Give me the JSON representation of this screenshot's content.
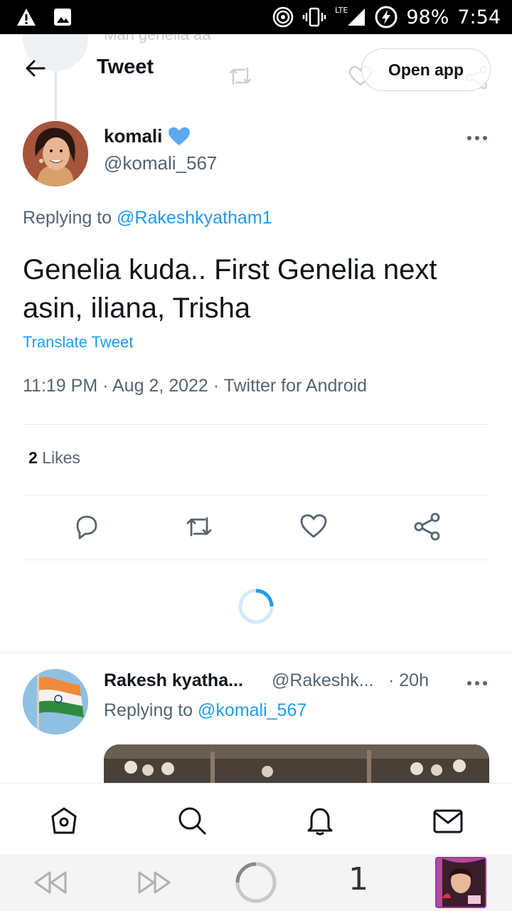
{
  "status_bar": {
    "battery": "98%",
    "time": "7:54",
    "network": "LTE",
    "icons": [
      "warning-icon",
      "image-icon",
      "hotspot-icon",
      "vibrate-icon",
      "signal-icon",
      "battery-charging-icon"
    ]
  },
  "ghost_text": "Mari genelia aa",
  "header": {
    "title": "Tweet",
    "open_app_label": "Open app"
  },
  "tweet": {
    "author_name": "komali",
    "author_handle": "@komali_567",
    "replying_prefix": "Replying to",
    "replying_to": "@Rakeshkyatham1",
    "text": "Genelia kuda.. First Genelia next asin, iliana, Trisha",
    "translate_label": "Translate Tweet",
    "meta": "11:19 PM · Aug 2, 2022 · Twitter for Android",
    "likes_count": "2",
    "likes_label": "Likes"
  },
  "reply": {
    "author_name": "Rakesh kyatha...",
    "author_handle": "@Rakeshk...",
    "time": "· 20h",
    "replying_prefix": "Replying to",
    "replying_to": "@komali_567"
  },
  "browser": {
    "tab_count": "1"
  },
  "colors": {
    "accent": "#1d9bf0",
    "verified": "#5aa9f2",
    "secondary_text": "#536471",
    "primary_text": "#0f1419"
  }
}
